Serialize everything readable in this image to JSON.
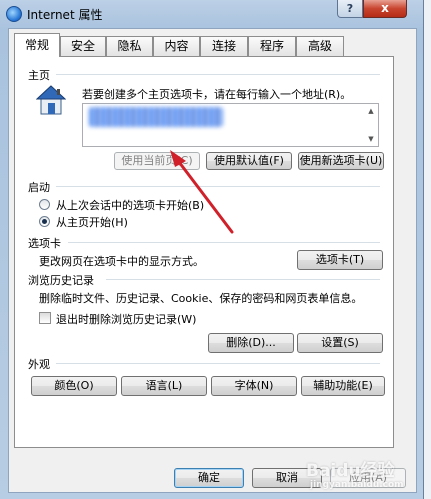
{
  "window": {
    "title": "Internet 属性",
    "help_label": "?",
    "close_label": "x"
  },
  "tabs": [
    {
      "label": "常规",
      "active": true
    },
    {
      "label": "安全"
    },
    {
      "label": "隐私"
    },
    {
      "label": "内容"
    },
    {
      "label": "连接"
    },
    {
      "label": "程序"
    },
    {
      "label": "高级"
    }
  ],
  "homepage": {
    "section": "主页",
    "instruction": "若要创建多个主页选项卡，请在每行输入一个地址(R)。",
    "btn_current": "使用当前页(C)",
    "btn_default": "使用默认值(F)",
    "btn_new_tab": "使用新选项卡(U)"
  },
  "startup": {
    "section": "启动",
    "option_last_session": "从上次会话中的选项卡开始(B)",
    "option_homepage": "从主页开始(H)"
  },
  "tabs_section": {
    "section": "选项卡",
    "description": "更改网页在选项卡中的显示方式。",
    "button": "选项卡(T)"
  },
  "history": {
    "section": "浏览历史记录",
    "description": "删除临时文件、历史记录、Cookie、保存的密码和网页表单信息。",
    "checkbox_label": "退出时删除浏览历史记录(W)",
    "btn_delete": "删除(D)...",
    "btn_settings": "设置(S)"
  },
  "appearance": {
    "section": "外观",
    "btn_colors": "颜色(O)",
    "btn_languages": "语言(L)",
    "btn_fonts": "字体(N)",
    "btn_accessibility": "辅助功能(E)"
  },
  "footer": {
    "btn_ok": "确定",
    "btn_cancel": "取消",
    "btn_apply": "应用(A)"
  },
  "watermark": {
    "line1": "Baidu经验",
    "line2": "jingyan.baidu.com"
  },
  "colors": {
    "arrow": "#d0202a",
    "accent": "#3c7fb1"
  }
}
